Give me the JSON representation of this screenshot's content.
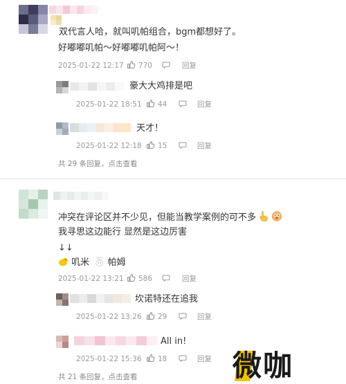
{
  "comments": [
    {
      "lines": [
        "双代言人哈，就叫叽帕组合，bgm都想好了。",
        "好嘟嘟叽帕～好嘟嘟叽帕阿～！"
      ],
      "time": "2025-01-22 12:17",
      "likes": "770",
      "reply_label": "回复",
      "replies": [
        {
          "text": "豪大大鸡排是吧",
          "time": "2025-01-22 18:51",
          "likes": "44",
          "reply_label": "回复"
        },
        {
          "text": "天才！",
          "time": "2025-01-22 12:18",
          "likes": "15",
          "reply_label": "回复"
        }
      ],
      "summary": "共 29 条回复，点击查看"
    },
    {
      "lines": [
        "冲突在评论区并不少见，但能当教学案例的可不多",
        "我寻思这边能行 显然是这边厉害",
        "↓↓",
        "叽米",
        "帕姆"
      ],
      "time": "2025-01-22 13:21",
      "likes": "586",
      "reply_label": "回复",
      "replies": [
        {
          "text": "坎诺特还在追我",
          "time": "2025-01-22 13:26",
          "likes": "29",
          "reply_label": "回复"
        },
        {
          "text": "All in!",
          "time": "2025-01-22 15:36",
          "likes": "18",
          "reply_label": "回复"
        }
      ],
      "summary": "共 21 条回复，点击查看"
    }
  ],
  "watermark": "微咖",
  "icons": {
    "like": "thumbs-up-icon",
    "comment": "comment-bubble-icon",
    "emoji_hand": "pointing-hand-emoji",
    "emoji_face": "surprised-face-emoji",
    "emoji_chick": "chick-icon",
    "emoji_bunny": "bunny-icon"
  },
  "colors": {
    "text": "#333333",
    "meta": "#999999",
    "divider": "#e6e6e6",
    "watermark_dark": "#1a1a1a",
    "watermark_accent": "#f2c200"
  }
}
